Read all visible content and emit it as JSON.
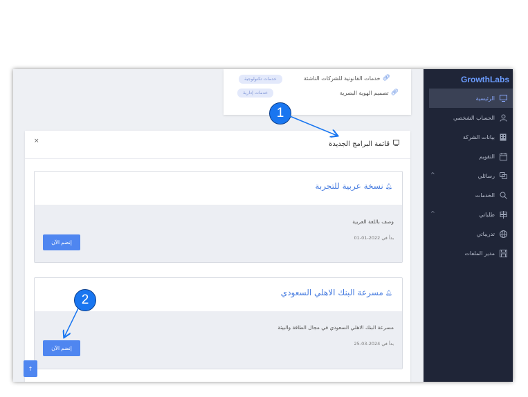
{
  "sidebar": {
    "brand": "GrowthLabs",
    "items": [
      {
        "label": "الرئيسية",
        "icon": "monitor-icon",
        "active": true
      },
      {
        "label": "الحساب الشخصي",
        "icon": "user-icon"
      },
      {
        "label": "بيانات الشركة",
        "icon": "building-icon"
      },
      {
        "label": "التقويم",
        "icon": "calendar-icon"
      },
      {
        "label": "رسائلي",
        "icon": "chat-icon",
        "caret": "^"
      },
      {
        "label": "الخدمات",
        "icon": "search-icon"
      },
      {
        "label": "طلباتي",
        "icon": "signpost-icon",
        "caret": "^"
      },
      {
        "label": "تدريباتي",
        "icon": "globe-icon"
      },
      {
        "label": "مدير الملفات",
        "icon": "save-icon"
      }
    ]
  },
  "top_card": {
    "services": [
      {
        "label": "خدمات القانونية للشركات الناشئة",
        "tag": "خدمات تكنولوجية"
      },
      {
        "label": "تصميم الهوية البصرية",
        "tag": "خدمات إدارية"
      }
    ]
  },
  "panel": {
    "title": "قائمة البرامج الجديدة",
    "close": "×",
    "programs": [
      {
        "title": "نسخة عربية للتجربة",
        "description": "وصف باللغة العربية",
        "started": "بدأ في 2022-01-01",
        "button": "إنضم الآن"
      },
      {
        "title": "مسرعة البنك الاهلي السعودي",
        "description": "مسرعة البنك الاهلي السعودي في مجال الطاقة والبيئة",
        "started": "بدأ في 2024-03-25",
        "button": "إنضم الآن"
      }
    ]
  },
  "scroll_top": "↑",
  "callouts": [
    "1",
    "2"
  ],
  "colors": {
    "accent": "#4f86f0",
    "sidebar": "#1f2537",
    "callout": "#1976f0"
  }
}
